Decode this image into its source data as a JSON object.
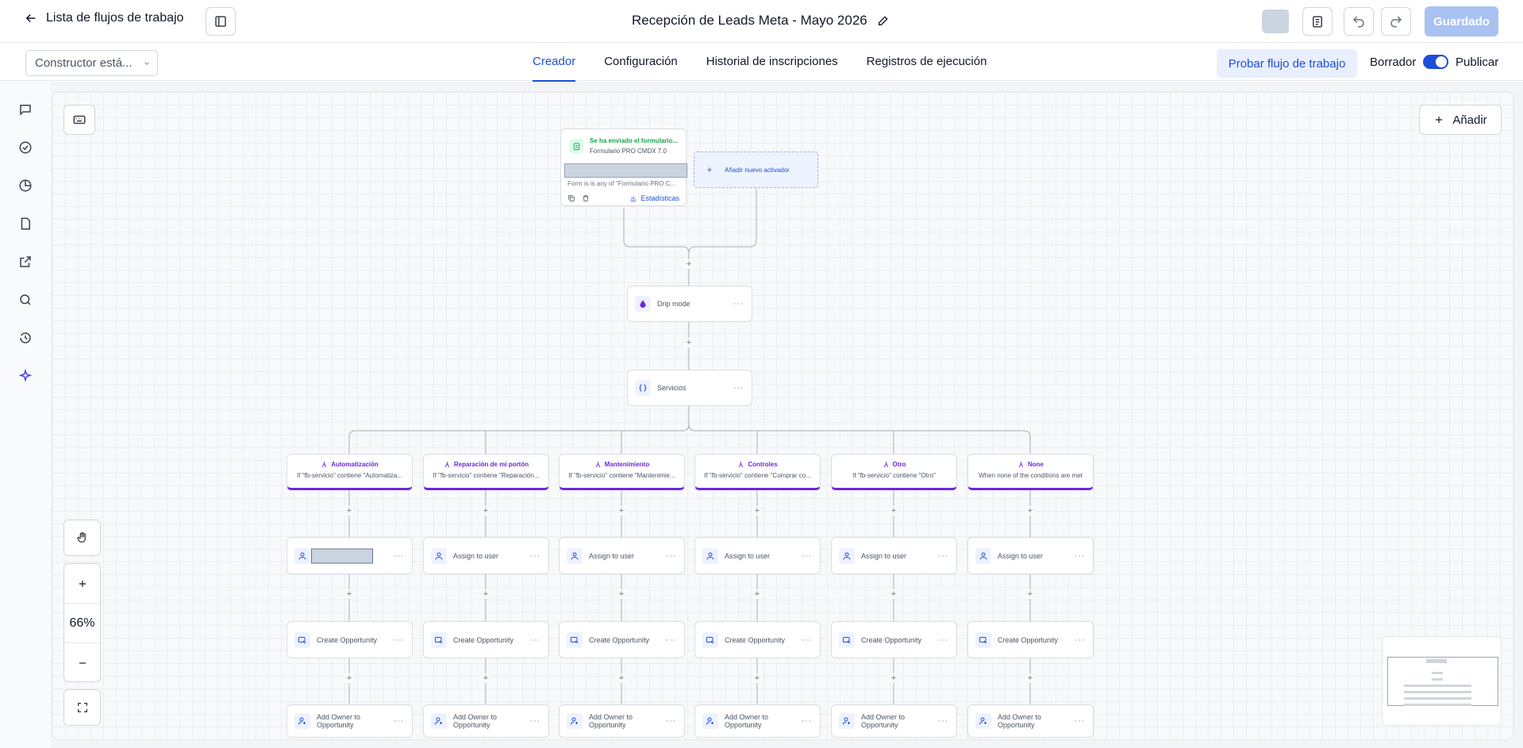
{
  "header": {
    "back_label": "Lista de flujos de trabajo",
    "title": "Recepción de Leads Meta - Mayo 2026",
    "save_label": "Guardado"
  },
  "subbar": {
    "builder_select": "Constructor está...",
    "tabs": [
      "Creador",
      "Configuración",
      "Historial de inscripciones",
      "Registros de ejecución"
    ],
    "active_tab": "Creador",
    "test_label": "Probar flujo de trabajo",
    "draft_label": "Borrador",
    "publish_label": "Publicar"
  },
  "canvas": {
    "add_label": "Añadir",
    "zoom": "66%",
    "trigger": {
      "title": "Se ha enviado el formulario...",
      "subtitle": "Formulario PRO CMDX 7.0",
      "condition": "Form is is any of \"Formulario PRO C...",
      "stats_label": "Estadísticas"
    },
    "add_trigger_label": "Añadir nuevo activador",
    "drip_label": "Drip mode",
    "services_label": "Servicios",
    "branches": [
      {
        "name": "Automatización",
        "cond": "If \"fb-servicio\" contiene \"Automatiza..."
      },
      {
        "name": "Reparación de mi portón",
        "cond": "If \"fb-servicio\" contiene \"Reparación..."
      },
      {
        "name": "Mantenimiento",
        "cond": "If \"fb-servicio\" contiene \"Mantenimie..."
      },
      {
        "name": "Controles",
        "cond": "If \"fb-servicio\" contiene \"Comprar co..."
      },
      {
        "name": "Otro",
        "cond": "If \"fb-servicio\" contiene \"Otro\""
      },
      {
        "name": "None",
        "cond": "When none of the conditions are met"
      }
    ],
    "assign_label": "Assign to user",
    "create_opp_label": "Create Opportunity",
    "add_owner_label": "Add Owner to Opportunity"
  },
  "colors": {
    "accent": "#1d4ed8",
    "branch": "#6d28d9",
    "trigger_green": "#16a34a"
  }
}
